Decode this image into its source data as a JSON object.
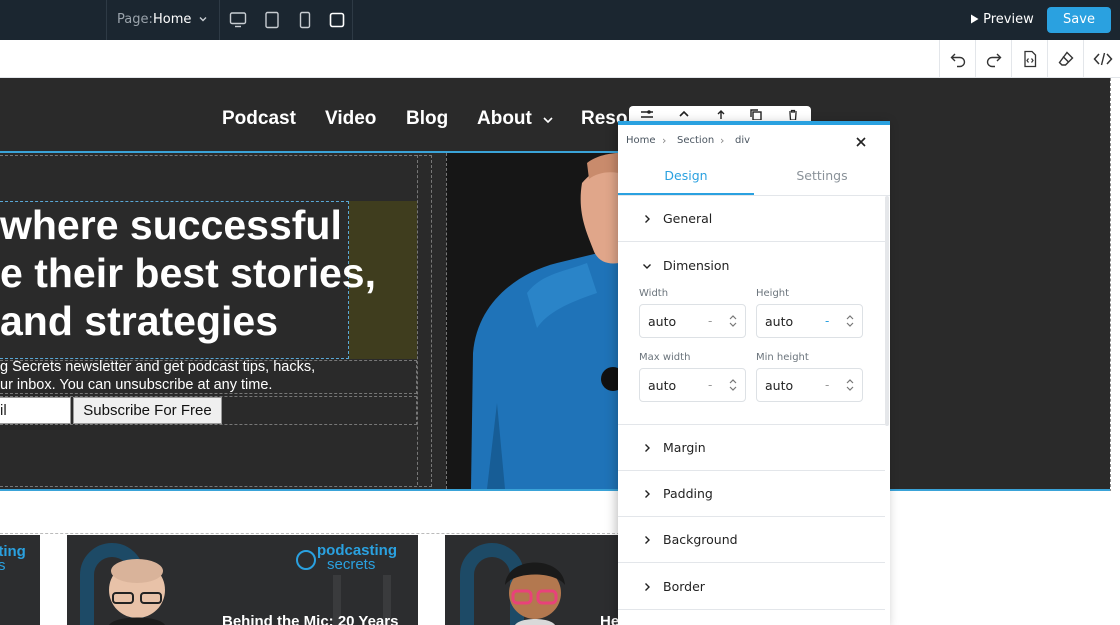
{
  "topbar": {
    "page_label": "Page:",
    "page_value": "Home",
    "preview_label": "Preview",
    "save_label": "Save",
    "devices": [
      "desktop-icon",
      "tablet-icon",
      "mobile-icon",
      "square-icon"
    ]
  },
  "toolbar": {
    "tools": [
      "undo-icon",
      "redo-icon",
      "code-file-icon",
      "eraser-icon",
      "code-icon"
    ]
  },
  "site": {
    "nav": {
      "podcast": "Podcast",
      "video": "Video",
      "blog": "Blog",
      "about": "About",
      "resources": "Reso"
    },
    "hero": {
      "heading_line1": "where successful",
      "heading_line2": "e their best stories,",
      "heading_line3": " and strategies",
      "para_line1": "g Secrets newsletter and get podcast tips, hacks,",
      "para_line2": "ur inbox. You can unsubscribe at any time.",
      "email_value": "il",
      "subscribe_label": "Subscribe For Free"
    },
    "cards": {
      "card1_brand": "sting",
      "card1_brand2": "s",
      "card2_brand1": "podcasting",
      "card2_brand2": "secrets",
      "card2_title": "Behind the Mic: 20 Years",
      "card3_title": "He"
    }
  },
  "panel": {
    "breadcrumb": [
      "Home",
      "Section",
      "div"
    ],
    "tabs": {
      "design": "Design",
      "settings": "Settings"
    },
    "sections": {
      "general": "General",
      "dimension": "Dimension",
      "margin": "Margin",
      "padding": "Padding",
      "background": "Background",
      "border": "Border"
    },
    "fields": {
      "width_label": "Width",
      "width_value": "auto",
      "width_unit": "-",
      "height_label": "Height",
      "height_value": "auto",
      "height_unit": "-",
      "max_width_label": "Max width",
      "max_width_value": "auto",
      "max_width_unit": "-",
      "min_height_label": "Min height",
      "min_height_value": "auto",
      "min_height_unit": "-"
    }
  },
  "colors": {
    "accent": "#2aa1e0",
    "topbar_bg": "#1b2630",
    "hero_bg": "#2a2a2a",
    "shirt_blue": "#1f73b8"
  }
}
